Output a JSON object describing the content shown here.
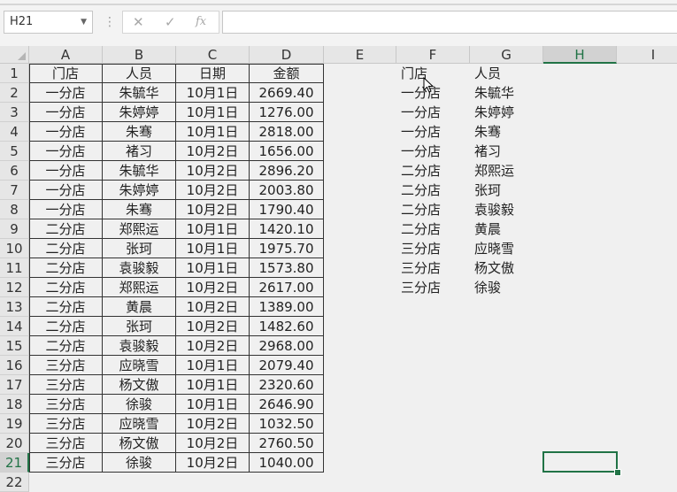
{
  "formula_bar": {
    "name_box": "H21",
    "cancel_glyph": "✕",
    "enter_glyph": "✓",
    "fx_glyph": "fx",
    "formula": ""
  },
  "columns": [
    "A",
    "B",
    "C",
    "D",
    "E",
    "F",
    "G",
    "H",
    "I"
  ],
  "selected": {
    "col": "H",
    "row": 21
  },
  "rows": [
    "1",
    "2",
    "3",
    "4",
    "5",
    "6",
    "7",
    "8",
    "9",
    "10",
    "11",
    "12",
    "13",
    "14",
    "15",
    "16",
    "17",
    "18",
    "19",
    "20",
    "21",
    "22"
  ],
  "table": {
    "headers": [
      "门店",
      "人员",
      "日期",
      "金额"
    ],
    "data": [
      [
        "一分店",
        "朱毓华",
        "10月1日",
        "2669.40"
      ],
      [
        "一分店",
        "朱婷婷",
        "10月1日",
        "1276.00"
      ],
      [
        "一分店",
        "朱骞",
        "10月1日",
        "2818.00"
      ],
      [
        "一分店",
        "褚习",
        "10月2日",
        "1656.00"
      ],
      [
        "一分店",
        "朱毓华",
        "10月2日",
        "2896.20"
      ],
      [
        "一分店",
        "朱婷婷",
        "10月2日",
        "2003.80"
      ],
      [
        "一分店",
        "朱骞",
        "10月2日",
        "1790.40"
      ],
      [
        "二分店",
        "郑熙运",
        "10月1日",
        "1420.10"
      ],
      [
        "二分店",
        "张珂",
        "10月1日",
        "1975.70"
      ],
      [
        "二分店",
        "袁骏毅",
        "10月1日",
        "1573.80"
      ],
      [
        "二分店",
        "郑熙运",
        "10月2日",
        "2617.00"
      ],
      [
        "二分店",
        "黄晨",
        "10月2日",
        "1389.00"
      ],
      [
        "二分店",
        "张珂",
        "10月2日",
        "1482.60"
      ],
      [
        "二分店",
        "袁骏毅",
        "10月2日",
        "2968.00"
      ],
      [
        "三分店",
        "应晓雪",
        "10月1日",
        "2079.40"
      ],
      [
        "三分店",
        "杨文傲",
        "10月1日",
        "2320.60"
      ],
      [
        "三分店",
        "徐骏",
        "10月1日",
        "2646.90"
      ],
      [
        "三分店",
        "应晓雪",
        "10月2日",
        "1032.50"
      ],
      [
        "三分店",
        "杨文傲",
        "10月2日",
        "2760.50"
      ],
      [
        "三分店",
        "徐骏",
        "10月2日",
        "1040.00"
      ]
    ]
  },
  "unique_list": {
    "headers": [
      "门店",
      "人员"
    ],
    "data": [
      [
        "一分店",
        "朱毓华"
      ],
      [
        "一分店",
        "朱婷婷"
      ],
      [
        "一分店",
        "朱骞"
      ],
      [
        "一分店",
        "褚习"
      ],
      [
        "二分店",
        "郑熙运"
      ],
      [
        "二分店",
        "张珂"
      ],
      [
        "二分店",
        "袁骏毅"
      ],
      [
        "二分店",
        "黄晨"
      ],
      [
        "三分店",
        "应晓雪"
      ],
      [
        "三分店",
        "杨文傲"
      ],
      [
        "三分店",
        "徐骏"
      ]
    ]
  },
  "colors": {
    "accent": "#217346",
    "border": "#333333"
  }
}
